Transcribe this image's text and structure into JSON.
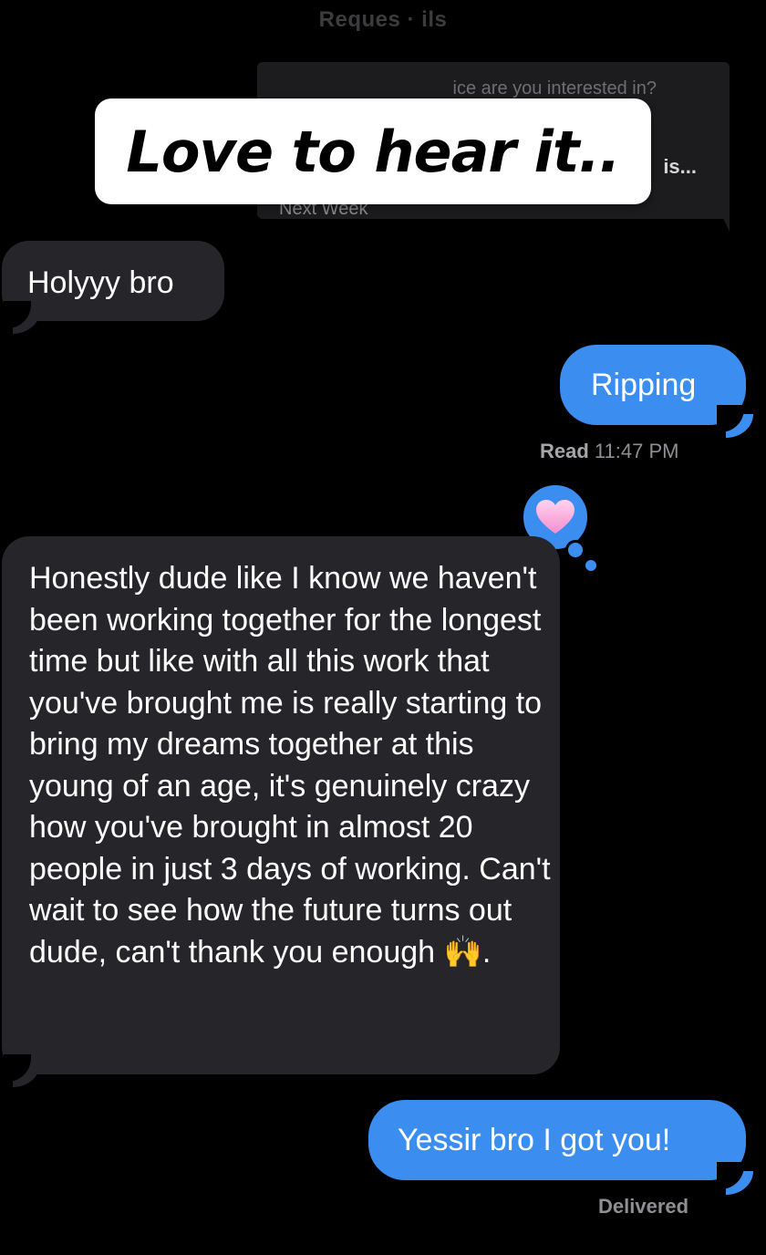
{
  "header": {
    "faded_title": "Reques   ·  ils"
  },
  "quoted_reply": {
    "top_line": "ice are you interested in?",
    "right_snippet": "is...",
    "bottom_line": "Next Week"
  },
  "sticker": {
    "text": "Love to hear it.."
  },
  "messages": [
    {
      "direction": "incoming",
      "text": "Holyyy bro"
    },
    {
      "direction": "outgoing",
      "text": "Ripping"
    },
    {
      "direction": "incoming",
      "text": "Honestly dude like I know we haven't been working together for the longest time but like with all this work that you've brought me is really starting to bring my dreams together at this young of an age, it's genuinely crazy how you've brought in almost 20 people in just 3 days of working. Can't wait to see how the future turns out dude, can't thank you enough 🙌."
    },
    {
      "direction": "outgoing",
      "text": "Yessir bro I got you!"
    }
  ],
  "read_receipt": {
    "label": "Read",
    "time": "11:47 PM"
  },
  "tapback": {
    "icon": "heart-icon",
    "color": "#f7a8d8"
  },
  "delivered_label": "Delivered",
  "colors": {
    "outgoing_bubble": "#3b8ef0",
    "incoming_bubble": "#26252a",
    "background": "#000000"
  }
}
